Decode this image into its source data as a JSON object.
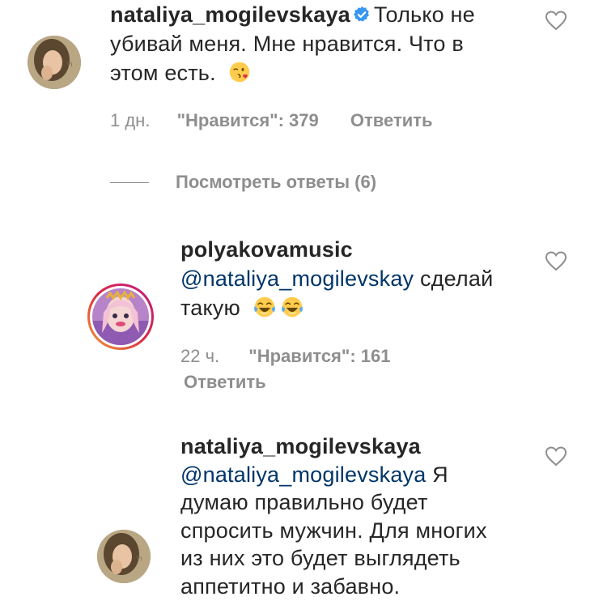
{
  "comments": [
    {
      "username": "nataliya_mogilevskaya",
      "verified": true,
      "text": "Только не убивай меня. Мне нравится. Что в этом есть.",
      "line1_text": "Только не",
      "line2": "убивай меня. Мне нравится. Что в",
      "line3": "этом есть.",
      "emoji": "kissing-face-emoji",
      "time": "1 дн.",
      "likes": "\"Нравится\": 379",
      "reply": "Ответить"
    },
    {
      "username": "polyakovamusic",
      "mention": "@nataliya_mogilevskay",
      "line2_rest": "сделай",
      "line3": "такую",
      "emoji": "tears-of-joy-emoji",
      "time": "22 ч.",
      "likes": "\"Нравится\": 161",
      "reply": "Ответить"
    },
    {
      "username": "nataliya_mogilevskaya",
      "mention": "@nataliya_mogilevskaya",
      "line2_rest": "Я",
      "line3": "думаю правильно будет",
      "line4": "спросить мужчин. Для многих",
      "line5": "из них это будет выглядеть",
      "line6": "аппетитно и забавно."
    }
  ],
  "view_replies": "Посмотреть ответы (6)",
  "colors": {
    "text": "#262626",
    "meta": "#8e8e8e",
    "mention": "#003569",
    "verified": "#3897f0",
    "heart": "#8e8e8e"
  }
}
